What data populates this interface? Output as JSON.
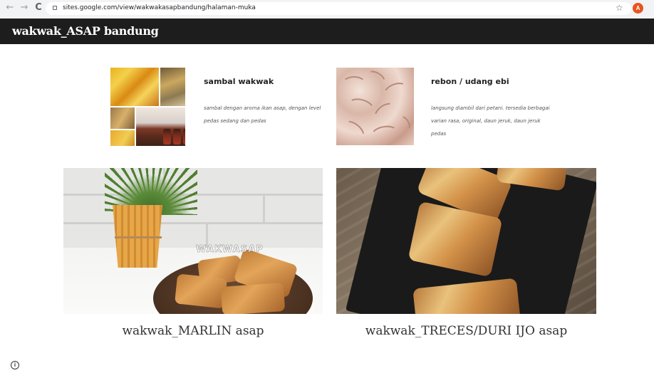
{
  "browser": {
    "url": "sites.google.com/view/wakwakasapbandung/halaman-muka",
    "back_glyph": "←",
    "forward_glyph": "→",
    "reload_glyph": "C",
    "star_glyph": "☆",
    "profile_initial": "A"
  },
  "site": {
    "title": "wakwak_ASAP bandung"
  },
  "products": [
    {
      "title": "sambal wakwak",
      "description": "sambal dengan aroma ikan asap, dengan level pedas sedang dan pedas"
    },
    {
      "title": "rebon / udang ebi",
      "description": "langsung diambil dari petani. tersedia berbagai varian rasa, original, daun jeruk, daun jeruk pedas"
    }
  ],
  "gallery": [
    {
      "caption": "wakwak_MARLIN asap",
      "watermark": "WAKWASAP"
    },
    {
      "caption": "wakwak_TRECES/DURI IJO asap"
    }
  ],
  "footer": {
    "info_glyph": "i"
  }
}
